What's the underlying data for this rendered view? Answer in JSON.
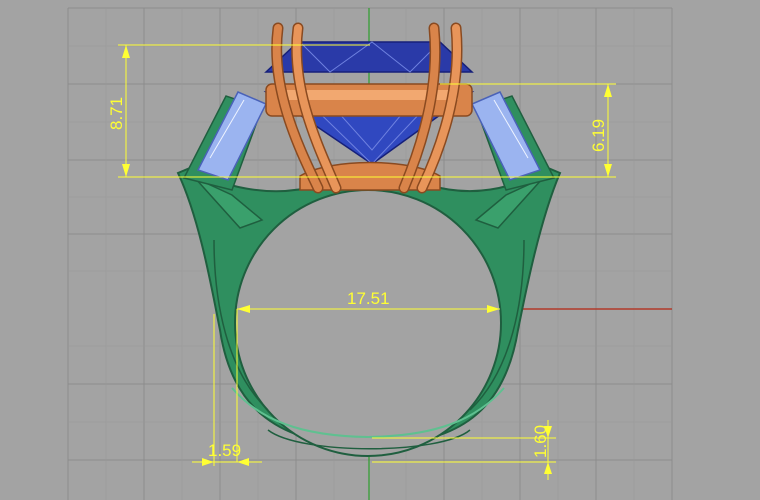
{
  "viewport": {
    "background": "#a3a3a3",
    "grid_color": "#8c8c8c",
    "grid_minor_color": "#999999",
    "y_axis_color": "#2e9e2e",
    "x_axis_color": "#b23a2a"
  },
  "model": {
    "band_color": "#2f8f5f",
    "band_edge_color": "#1f5f3f",
    "prong_color": "#d9844a",
    "prong_highlight": "#f2a870",
    "gem_center_color": "#2a3aa8",
    "gem_side_color": "#9bb4f0"
  },
  "dimension_color": "#ffff33",
  "dimensions": {
    "height_total": "8.71",
    "height_side": "6.19",
    "inner_diameter": "17.51",
    "shank_width": "1.59",
    "shank_thickness": "1.60"
  }
}
